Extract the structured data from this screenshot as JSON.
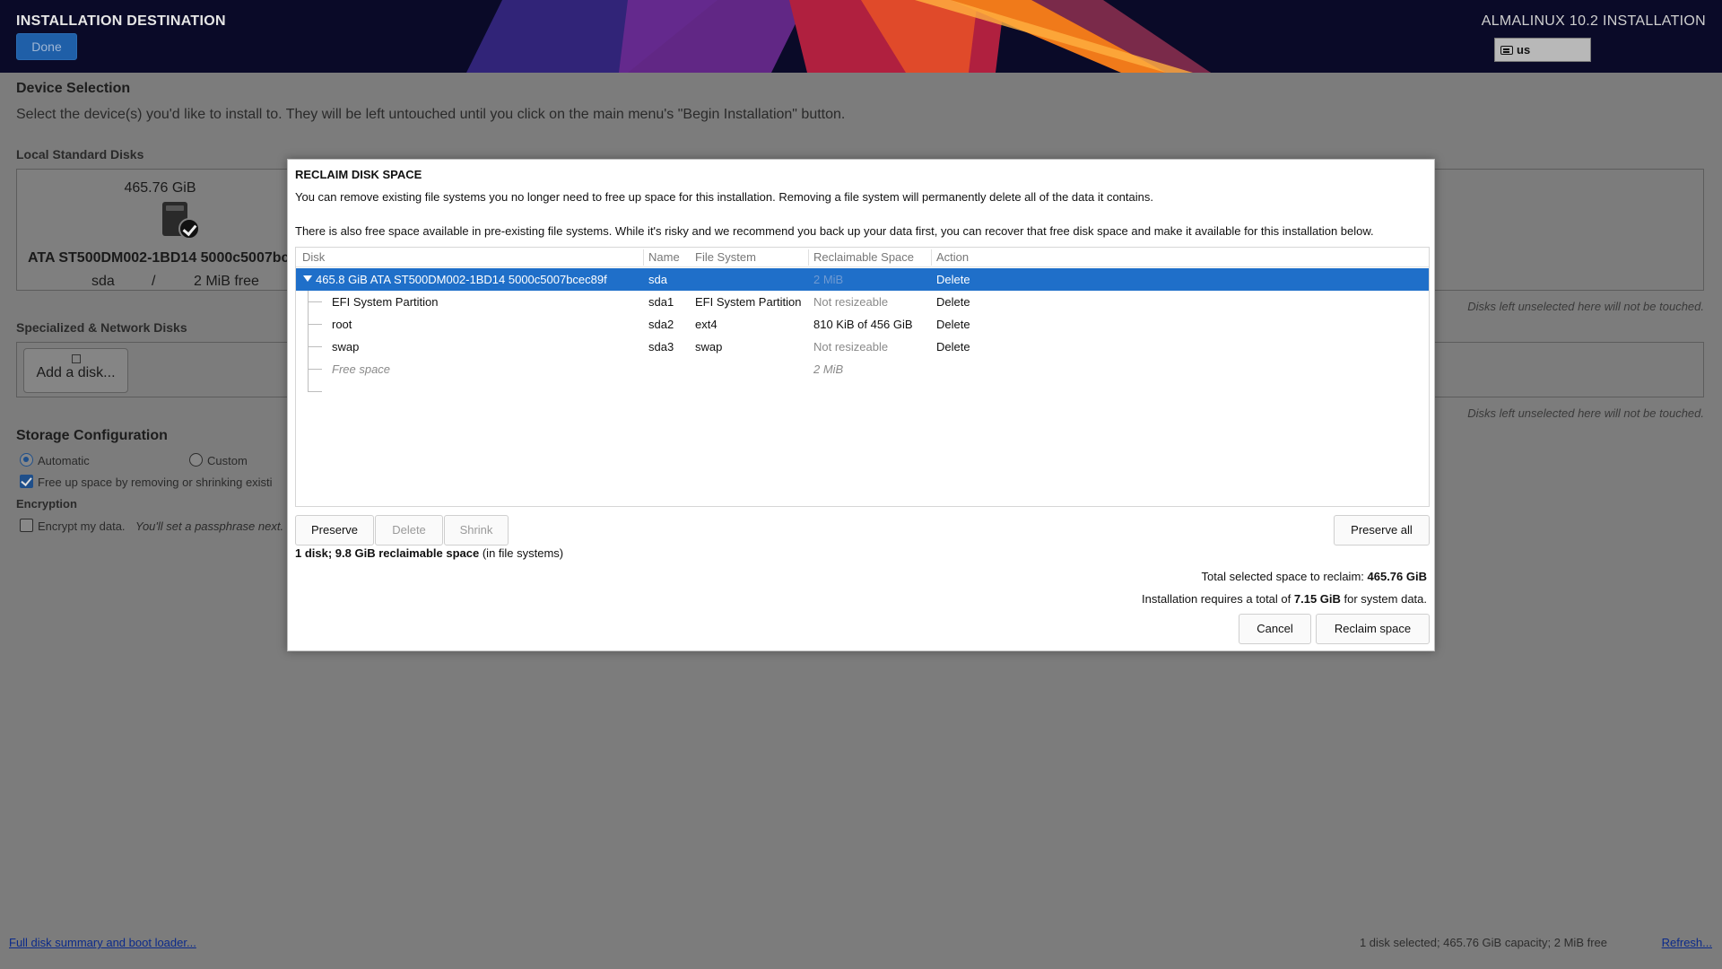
{
  "header": {
    "title": "INSTALLATION DESTINATION",
    "done_label": "Done",
    "product": "ALMALINUX 10.2 INSTALLATION",
    "keyboard_layout": "us"
  },
  "device_selection": {
    "heading": "Device Selection",
    "description": "Select the device(s) you'd like to install to.  They will be left untouched until you click on the main menu's \"Begin Installation\" button.",
    "local_disks_label": "Local Standard Disks",
    "disk": {
      "size": "465.76 GiB",
      "model": "ATA ST500DM002-1BD14 5000c5007bc",
      "name": "sda",
      "mount": "/",
      "free": "2 MiB free"
    },
    "hint_local": "Disks left unselected here will not be touched.",
    "specialized_label": "Specialized & Network Disks",
    "add_disk_label": "Add a disk...",
    "hint_network": "Disks left unselected here will not be touched."
  },
  "storage_config": {
    "heading": "Storage Configuration",
    "automatic_label": "Automatic",
    "custom_label": "Custom",
    "free_up_label": "Free up space by removing or shrinking existi",
    "encryption_label": "Encryption",
    "encrypt_label": "Encrypt my data.",
    "encrypt_hint": "You'll set a passphrase next."
  },
  "footer": {
    "summary_link": "Full disk summary and boot loader...",
    "status": "1 disk selected; 465.76 GiB capacity; 2 MiB free",
    "refresh_link": "Refresh..."
  },
  "dialog": {
    "title": "RECLAIM DISK SPACE",
    "line1": "You can remove existing file systems you no longer need to free up space for this installation.  Removing a file system will permanently delete all of the data it contains.",
    "line2": "There is also free space available in pre-existing file systems.  While it's risky and we recommend you back up your data first, you can recover that free disk space and make it available for this installation below.",
    "columns": [
      "Disk",
      "Name",
      "File System",
      "Reclaimable Space",
      "Action"
    ],
    "rows": [
      {
        "disk": "465.8 GiB ATA ST500DM002-1BD14 5000c5007bcec89f",
        "name": "sda",
        "fs": "",
        "space": "2 MiB",
        "action": "Delete"
      },
      {
        "disk": "EFI System Partition",
        "name": "sda1",
        "fs": "EFI System Partition",
        "space": "Not resizeable",
        "action": "Delete"
      },
      {
        "disk": "root",
        "name": "sda2",
        "fs": "ext4",
        "space": "810 KiB of 456 GiB",
        "action": "Delete"
      },
      {
        "disk": "swap",
        "name": "sda3",
        "fs": "swap",
        "space": "Not resizeable",
        "action": "Delete"
      },
      {
        "disk": "Free space",
        "name": "",
        "fs": "",
        "space": "2 MiB",
        "action": ""
      }
    ],
    "btn_preserve": "Preserve",
    "btn_delete": "Delete",
    "btn_shrink": "Shrink",
    "btn_preserve_all": "Preserve all",
    "summary_bold": "1 disk; 9.8 GiB reclaimable space",
    "summary_rest": " (in file systems)",
    "total_label": "Total selected space to reclaim: ",
    "total_value": "465.76 GiB",
    "requires_prefix": "Installation requires a total of ",
    "requires_value": "7.15 GiB",
    "requires_suffix": " for system data.",
    "btn_cancel": "Cancel",
    "btn_reclaim": "Reclaim space"
  }
}
